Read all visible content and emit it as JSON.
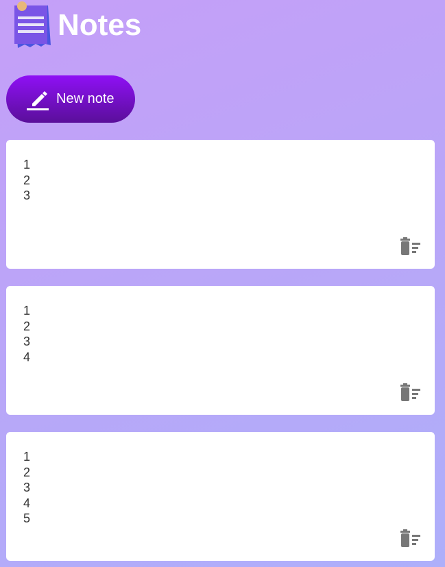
{
  "header": {
    "title": "Notes",
    "logo_icon": "sticky-note-icon"
  },
  "new_note_button": {
    "label": "New note",
    "icon": "pencil-icon"
  },
  "notes": [
    {
      "content": "1\n2\n3"
    },
    {
      "content": "1\n2\n3\n4"
    },
    {
      "content": "1\n2\n3\n4\n5"
    }
  ],
  "colors": {
    "accent": "#8f10f5",
    "delete_icon": "#777777"
  }
}
